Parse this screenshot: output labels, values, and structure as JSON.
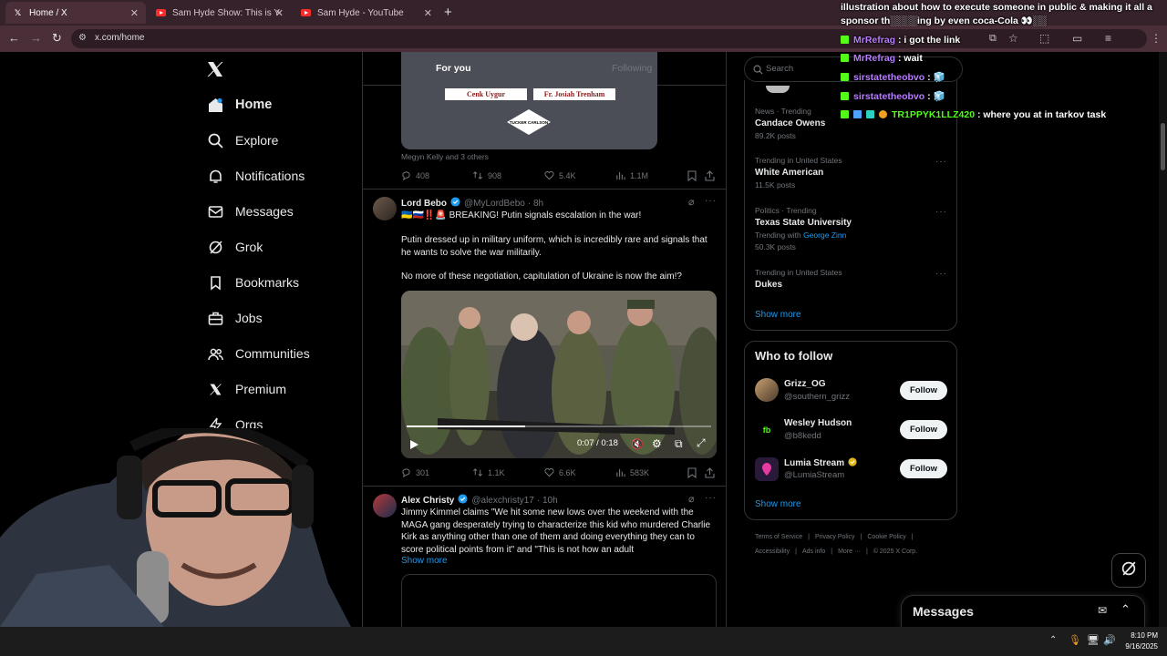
{
  "browser": {
    "tabs": [
      {
        "title": "Home / X",
        "icon": "x-logo-icon",
        "active": true
      },
      {
        "title": "Sam Hyde Show: This is You - Y",
        "icon": "youtube-icon",
        "active": false
      },
      {
        "title": "Sam Hyde - YouTube",
        "icon": "youtube-icon",
        "active": false
      }
    ],
    "url": "x.com/home",
    "new_tab": "+"
  },
  "sidebar": {
    "items": [
      {
        "label": "Home",
        "icon": "home-icon"
      },
      {
        "label": "Explore",
        "icon": "search-icon"
      },
      {
        "label": "Notifications",
        "icon": "bell-icon"
      },
      {
        "label": "Messages",
        "icon": "mail-icon"
      },
      {
        "label": "Grok",
        "icon": "grok-icon"
      },
      {
        "label": "Bookmarks",
        "icon": "bookmark-icon"
      },
      {
        "label": "Jobs",
        "icon": "briefcase-icon"
      },
      {
        "label": "Communities",
        "icon": "people-icon"
      },
      {
        "label": "Premium",
        "icon": "x-logo-icon"
      },
      {
        "label": "Orgs",
        "icon": "lightning-icon"
      }
    ]
  },
  "feed": {
    "tabs": [
      {
        "label": "For you"
      },
      {
        "label": "Following"
      }
    ],
    "prev_tweet": {
      "card_labels": [
        "Cenk Uygur",
        "Fr. Josiah Trenham"
      ],
      "card_logo": "TUCKER CARLSON",
      "liked_by": "Megyn Kelly and 3 others",
      "replies": "408",
      "reposts": "908",
      "likes": "5.4K",
      "views": "1.1M"
    },
    "tweets": [
      {
        "name": "Lord Bebo",
        "handle": "@MyLordBebo",
        "time": "· 8h",
        "line1": "🇺🇦🇷🇺‼️🚨 BREAKING! Putin signals escalation in the war!",
        "line2": "Putin dressed up in military uniform, which is incredibly rare and signals that he wants to solve the war militarily.",
        "line3": "No more of these negotiation, capitulation of Ukraine is now the aim!?",
        "video_time": "0:07 / 0:18",
        "replies": "301",
        "reposts": "1.1K",
        "likes": "6.6K",
        "views": "583K"
      },
      {
        "name": "Alex Christy",
        "handle": "@alexchristy17",
        "time": "· 10h",
        "text": "Jimmy Kimmel claims \"We hit some new lows over the weekend with the MAGA gang desperately trying to characterize this kid who murdered Charlie Kirk as anything other than one of them and doing everything they can to score political points from it\" and \"This is not how an adult",
        "show_more": "Show more"
      }
    ]
  },
  "right": {
    "search_placeholder": "Search",
    "trends": [
      {
        "category": "News · Trending",
        "name": "Candace Owens",
        "count": "89.2K posts"
      },
      {
        "category": "Trending in United States",
        "name": "White American",
        "count": "11.5K posts"
      },
      {
        "category": "Politics · Trending",
        "name": "Texas State University",
        "with_label": "Trending with",
        "with": "George Zinn",
        "count": "50.3K posts"
      },
      {
        "category": "Trending in United States",
        "name": "Dukes",
        "count": ""
      }
    ],
    "trends_show_more": "Show more",
    "who_to_follow": {
      "title": "Who to follow",
      "users": [
        {
          "name": "Grizz_OG",
          "handle": "@southern_grizz",
          "button": "Follow"
        },
        {
          "name": "Wesley Hudson",
          "handle": "@b8kedd",
          "button": "Follow"
        },
        {
          "name": "Lumia Stream",
          "handle": "@LumiaStream",
          "button": "Follow"
        }
      ],
      "show_more": "Show more"
    },
    "footer": {
      "line1": [
        "Terms of Service",
        "Privacy Policy",
        "Cookie Policy"
      ],
      "line2": [
        "Accessibility",
        "Ads info",
        "More ···",
        "© 2025 X Corp."
      ]
    }
  },
  "messages_drawer": {
    "title": "Messages"
  },
  "chat_overlay": {
    "header": "illustration about how to execute someone in public & making it all a sponsor th░░░░ing by even coca-Cola 👀░░",
    "messages": [
      {
        "user": "MrRefrag",
        "text": ": i got the link",
        "color": "#b77cff"
      },
      {
        "user": "MrRefrag",
        "text": ": wait",
        "color": "#b77cff"
      },
      {
        "user": "sirstatetheobvo",
        "text": ":",
        "color": "#b77cff"
      },
      {
        "user": "sirstatetheobvo",
        "text": ":",
        "color": "#b77cff"
      },
      {
        "user": "TR1PPYK1LLZ420",
        "text": ": where you at in tarkov task",
        "color": "#53fc18"
      }
    ]
  },
  "taskbar": {
    "time": "8:10 PM",
    "date": "9/16/2025"
  },
  "colors": {
    "accent": "#1d9bf0",
    "background": "#000000",
    "follow_bg": "#eff3f4",
    "chat_green": "#53fc18"
  }
}
